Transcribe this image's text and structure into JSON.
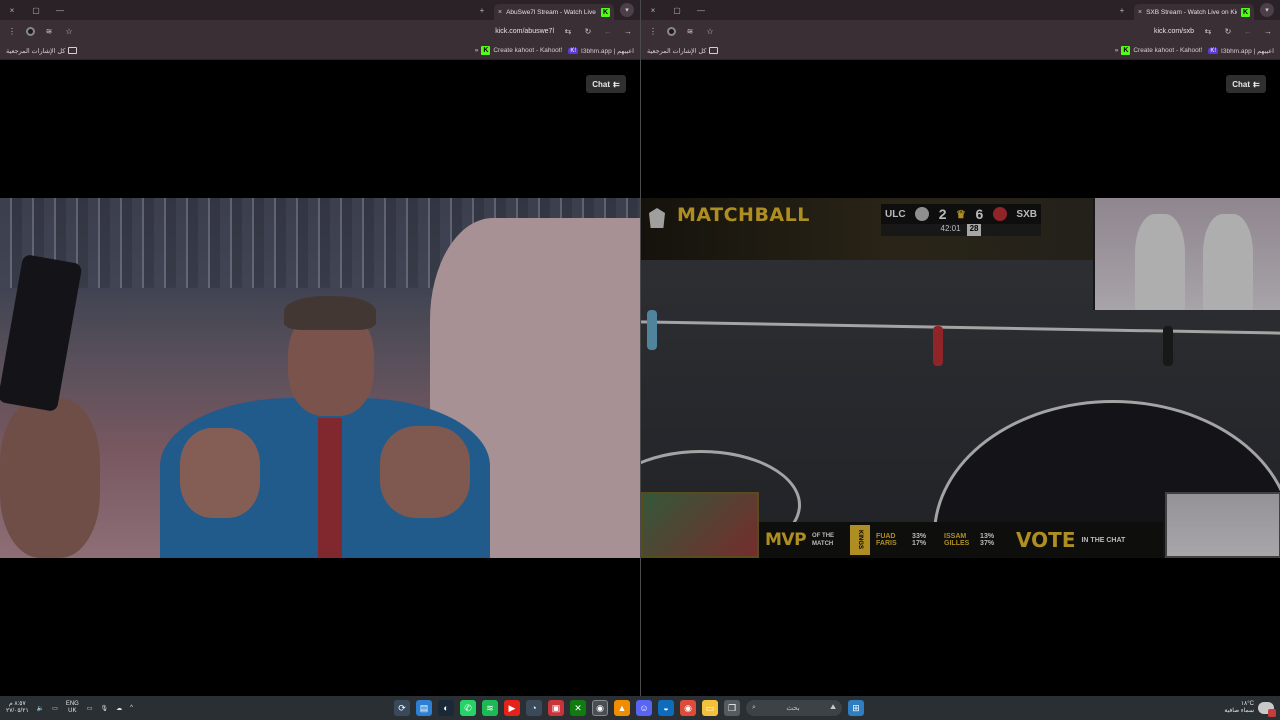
{
  "left_window": {
    "tab_title": "AbuSwe7l Stream - Watch Live on Kick",
    "url": "kick.com/abuswe7l",
    "bookmarks": [
      {
        "label": "Create kahoot - Kahoot!",
        "badge": ""
      },
      {
        "label": "I3bhm.app | اعيبهم",
        "badge": "K!"
      }
    ],
    "all_bookmarks_label": "كل الإشارات المرجعية",
    "chat_label": "Chat",
    "new_tab_symbol": "+",
    "close_symbol": "×"
  },
  "right_window": {
    "tab_title": "SXB Stream - Watch Live on Kick",
    "url": "kick.com/sxb",
    "bookmarks": [
      {
        "label": "Create kahoot - Kahoot!",
        "badge": ""
      },
      {
        "label": "I3bhm.app | اعيبهم",
        "badge": "K!"
      }
    ],
    "all_bookmarks_label": "كل الإشارات المرجعية",
    "chat_label": "Chat",
    "new_tab_symbol": "+",
    "close_symbol": "×",
    "stream_overlay": {
      "brand": "MATCHBALL",
      "scoreboard": {
        "home_team": "ULC",
        "home_score": "2",
        "away_score": "6",
        "away_team": "SXB",
        "clock": "42:01",
        "shot_clock": "28"
      },
      "mvp": {
        "title": "MVP",
        "subtitle": "OF THE MATCH",
        "league_tag": "KINGS",
        "candidates": [
          {
            "name": "FUAD",
            "pct": "33%"
          },
          {
            "name": "FARIS",
            "pct": "17%"
          },
          {
            "name": "ISSAM",
            "pct": "13%"
          },
          {
            "name": "GILLES",
            "pct": "37%"
          }
        ],
        "vote_title": "VOTE",
        "vote_subtitle": "IN THE CHAT"
      }
    }
  },
  "taskbar": {
    "time": "٨:٥٧ م",
    "date": "٢٧/٠٥/٢١",
    "language": "ENG",
    "language_region": "UK",
    "search_placeholder": "بحث",
    "weather_temp": "١٨°C",
    "weather_desc": "سماء صافية",
    "icons": [
      "refresh-icon",
      "notepad-icon",
      "steam-icon",
      "whatsapp-icon",
      "spotify-icon",
      "youtube-icon",
      "edge-icon",
      "media-icon",
      "xbox-icon",
      "chrome-icon",
      "vlc-icon",
      "discord-icon",
      "edge-alt-icon",
      "chrome-alt-icon",
      "explorer-icon",
      "taskview-icon",
      "start-icon"
    ]
  },
  "colors": {
    "kick_green": "#53fc18",
    "chrome_frame": "#3b2f36",
    "matchball_gold": "#f1c531"
  }
}
